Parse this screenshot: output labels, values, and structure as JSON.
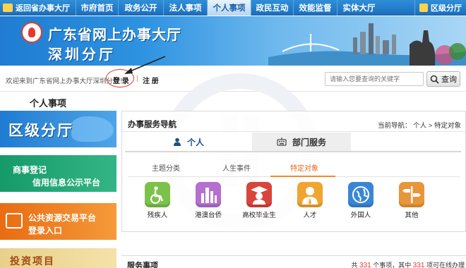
{
  "topnav": {
    "home": "返回省办事大厅",
    "items": [
      "市府首页",
      "政务公开",
      "法人事项",
      "个人事项",
      "政民互动",
      "效能监督",
      "实体大厅"
    ],
    "active_index": 3,
    "district": "区级分厅"
  },
  "banner": {
    "title_line1": "广东省网上办事大厅",
    "title_line2": "深圳分厅"
  },
  "loginbar": {
    "welcome": "欢迎来到广东省网上办事大厅深圳分厅！",
    "login": "登 录",
    "separator": "|",
    "register": "注 册",
    "search_placeholder": "请输入您要查询的关键字",
    "search_button": "查询"
  },
  "left": {
    "section_title": "个人事项",
    "banner1": "区级分厅",
    "banner2_line1": "商事登记",
    "banner2_line2": "信用信息公示平台",
    "banner3_line1": "公共资源交易平台",
    "banner3_line2": "登录入口",
    "banner4": "投资项目"
  },
  "panel": {
    "title": "办事服务导航",
    "breadcrumb": "当前导航：  个人 > 特定对象",
    "tab_person": "个人",
    "tab_dept": "部门服务",
    "subtabs": [
      "主题分类",
      "人生事件",
      "特定对象"
    ],
    "active_subtab": 2,
    "icons": [
      {
        "label": "残疾人",
        "color": "#7cc24a",
        "icon": "wheelchair-icon"
      },
      {
        "label": "港澳台侨",
        "color": "#b46fd0",
        "icon": "city-icon"
      },
      {
        "label": "高校毕业生",
        "color": "#d8453c",
        "icon": "graduate-icon"
      },
      {
        "label": "人才",
        "color": "#f0a530",
        "icon": "talent-icon"
      },
      {
        "label": "外国人",
        "color": "#3a86d6",
        "icon": "globe-icon"
      },
      {
        "label": "其他",
        "color": "#e8963a",
        "icon": "signpost-icon"
      }
    ]
  },
  "bottom": {
    "title": "服务事项",
    "stats_prefix": "共",
    "total": "331",
    "stats_mid": "个事项，其中",
    "online": "331",
    "stats_suffix": "项可在线办理"
  }
}
